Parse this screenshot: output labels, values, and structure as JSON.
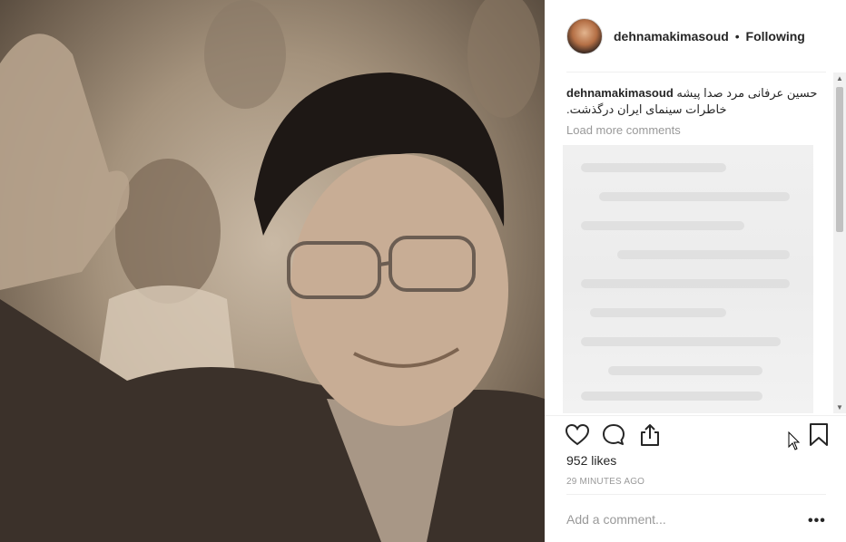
{
  "post": {
    "username": "dehnamakimasoud",
    "separator": "•",
    "follow_status": "Following"
  },
  "caption": {
    "username": "dehnamakimasoud",
    "text": "حسین عرفانی مرد صدا پیشه خاطرات سینمای ایران درگذشت."
  },
  "comments": {
    "load_more_label": "Load more comments"
  },
  "icons": {
    "like": "heart-icon",
    "comment": "comment-icon",
    "share": "share-icon",
    "save": "bookmark-icon",
    "more": "more-options-icon"
  },
  "stats": {
    "likes": "952 likes",
    "time_ago": "29 MINUTES AGO"
  },
  "comment_box": {
    "placeholder": "Add a comment...",
    "value": "",
    "more_label": "•••"
  }
}
